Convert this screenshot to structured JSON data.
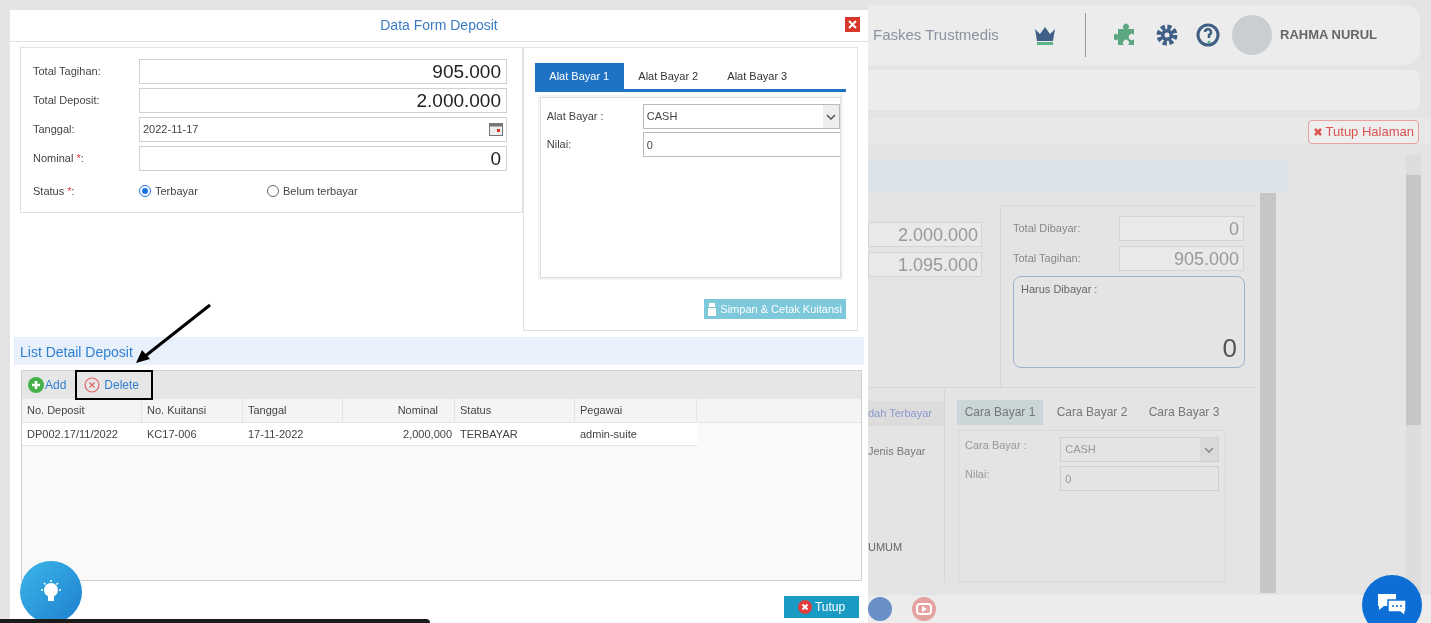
{
  "app_header": {
    "facility": "Faskes Trustmedis",
    "user_name": "RAHMA NURUL"
  },
  "page_toolbar": {
    "close_page_button": "Tutup Halaman"
  },
  "background_panel": {
    "amounts": [
      "2.000.000",
      "1.095.000"
    ],
    "summary": [
      {
        "label": "Total Dibayar:",
        "value": "0"
      },
      {
        "label": "Total Tagihan:",
        "value": "905.000"
      }
    ],
    "due": {
      "label": "Harus Dibayar :",
      "value": "0"
    },
    "status_tab": "dah Terbayar",
    "list_column": "Jenis Bayar",
    "list_row": "UMUM",
    "pay_tabs": [
      {
        "label": "Cara Bayar 1",
        "selected": true
      },
      {
        "label": "Cara Bayar 2",
        "selected": false
      },
      {
        "label": "Cara Bayar 3",
        "selected": false
      }
    ],
    "pay_form": {
      "method_label": "Cara Bayar :",
      "method": "CASH",
      "value_label": "Nilai:",
      "value": "0"
    }
  },
  "modal": {
    "title": "Data Form Deposit",
    "fields": [
      {
        "kind": "amount",
        "label": "Total Tagihan:",
        "value": "905.000"
      },
      {
        "kind": "amount",
        "label": "Total Deposit:",
        "value": "2.000.000"
      },
      {
        "kind": "date",
        "label": "Tanggal:",
        "value": "2022-11-17"
      },
      {
        "kind": "amount",
        "label": "Nominal ",
        "mark": "*",
        "suffix": ":",
        "value": "0"
      }
    ],
    "status": {
      "label": "Status ",
      "mark": "*",
      "suffix": ":",
      "options": [
        {
          "label": "Terbayar",
          "selected": true
        },
        {
          "label": "Belum terbayar",
          "selected": false
        }
      ]
    },
    "payment_tabs": [
      {
        "label": "Alat Bayar 1",
        "selected": true
      },
      {
        "label": "Alat Bayar 2",
        "selected": false
      },
      {
        "label": "Alat Bayar 3",
        "selected": false
      }
    ],
    "payment_form": {
      "method_label": "Alat Bayar :",
      "method": "CASH",
      "value_label": "Nilai:",
      "value": "0"
    },
    "save_button": "Simpan & Cetak Kuitansi",
    "list": {
      "title": "List Detail Deposit",
      "add_button": "Add",
      "delete_button": "Delete",
      "columns": [
        "No. Deposit",
        "No. Kuitansi",
        "Tanggal",
        "Nominal",
        "Status",
        "Pegawai"
      ],
      "rows": [
        [
          "DP002.17/11/2022",
          "KC17-006",
          "17-11-2022",
          "2,000,000",
          "TERBAYAR",
          "admin-suite"
        ]
      ]
    },
    "close_button": "Tutup"
  }
}
